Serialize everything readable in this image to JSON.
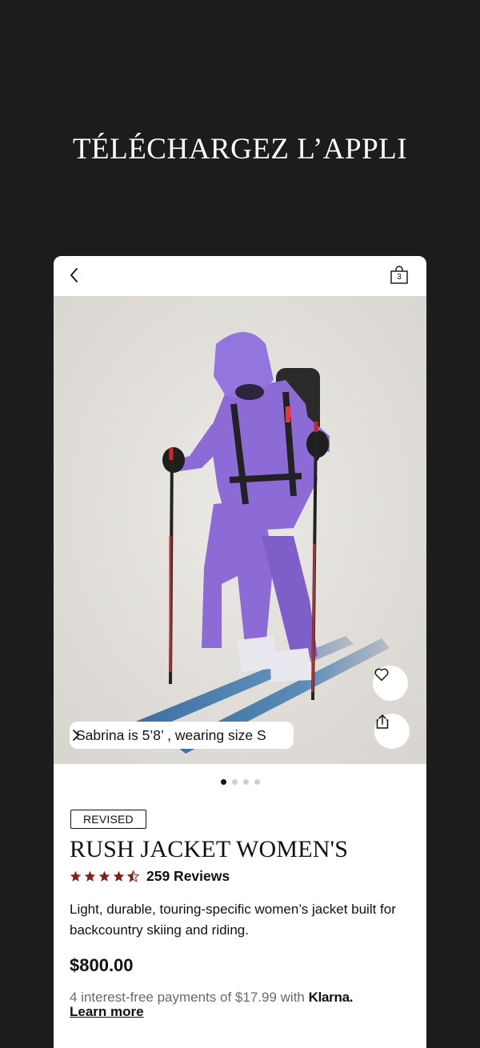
{
  "promo": {
    "headline": "TÉLÉCHARGEZ L’APPLI"
  },
  "header": {
    "back_icon": "chevron-left-icon",
    "bag_icon": "shopping-bag-icon",
    "bag_count": "3"
  },
  "gallery": {
    "model_info": "Sabrina is 5’8’ , wearing size S",
    "favorite_icon": "heart-icon",
    "share_icon": "share-icon",
    "image_count": 4,
    "active_image": 1
  },
  "product": {
    "badge": "REVISED",
    "title": "RUSH JACKET WOMEN'S",
    "rating": 4.5,
    "reviews_label": "259 Reviews",
    "description": "Light, durable, touring-specific women’s jacket built for backcountry skiing and riding.",
    "price": "$800.00",
    "installments_text": "4 interest-free payments of $17.99 with",
    "klarna_label": "Klarna.",
    "learn_more_label": "Learn more"
  },
  "colors": {
    "background": "#1c1c1c",
    "star": "#8b1a1a",
    "jacket": "#8d6bd6"
  }
}
